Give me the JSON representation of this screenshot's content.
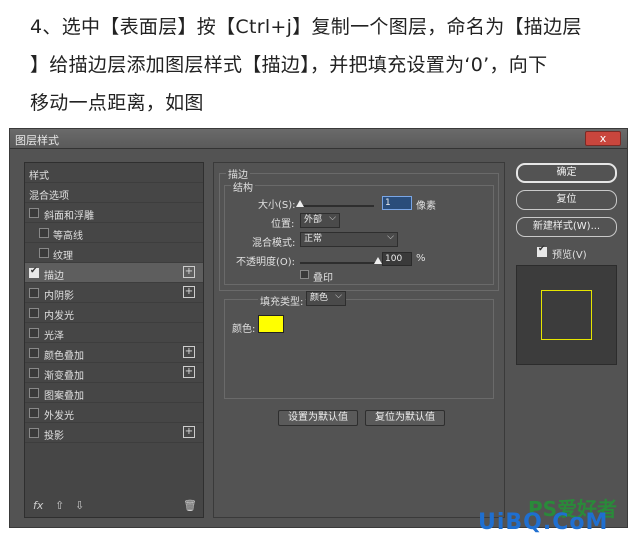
{
  "intro": {
    "line1": "4、选中【表面层】按【Ctrl+j】复制一个图层，命名为【描边层",
    "line2": "】给描边层添加图层样式【描边】，并把填充设置为‘0’，向下",
    "line3": "移动一点距离，如图"
  },
  "dialog": {
    "title": "图层样式",
    "close_label": "x"
  },
  "styles": {
    "header_styles": "样式",
    "header_blend": "混合选项",
    "items": [
      {
        "label": "斜面和浮雕",
        "checked": false,
        "plus": false,
        "sub": false
      },
      {
        "label": "等高线",
        "checked": false,
        "plus": false,
        "sub": true
      },
      {
        "label": "纹理",
        "checked": false,
        "plus": false,
        "sub": true
      },
      {
        "label": "描边",
        "checked": true,
        "plus": true,
        "sub": false
      },
      {
        "label": "内阴影",
        "checked": false,
        "plus": true,
        "sub": false
      },
      {
        "label": "内发光",
        "checked": false,
        "plus": false,
        "sub": false
      },
      {
        "label": "光泽",
        "checked": false,
        "plus": false,
        "sub": false
      },
      {
        "label": "颜色叠加",
        "checked": false,
        "plus": true,
        "sub": false
      },
      {
        "label": "渐变叠加",
        "checked": false,
        "plus": true,
        "sub": false
      },
      {
        "label": "图案叠加",
        "checked": false,
        "plus": false,
        "sub": false
      },
      {
        "label": "外发光",
        "checked": false,
        "plus": false,
        "sub": false
      },
      {
        "label": "投影",
        "checked": false,
        "plus": true,
        "sub": false
      }
    ],
    "fx_label": "fx",
    "plus_sign": "+"
  },
  "stroke": {
    "group_title": "描边",
    "structure_title": "结构",
    "size_label": "大小(S):",
    "size_value": "1",
    "size_unit": "像素",
    "position_label": "位置:",
    "position_value": "外部",
    "blend_label": "混合模式:",
    "blend_value": "正常",
    "opacity_label": "不透明度(O):",
    "opacity_value": "100",
    "opacity_unit": "%",
    "opacity_fraction": 1.0,
    "size_fraction": 0.0,
    "overprint_label": "叠印",
    "fill_type_label": "填充类型:",
    "fill_type_value": "颜色",
    "color_label": "颜色:",
    "color_value": "#ffff00",
    "set_default_label": "设置为默认值",
    "reset_default_label": "复位为默认值"
  },
  "buttons": {
    "ok": "确定",
    "reset": "复位",
    "new_style": "新建样式(W)...",
    "preview_label": "预览(V)"
  },
  "watermark": {
    "ps_text": "PS爱好者",
    "site_text": "UiBQ.CoM"
  }
}
